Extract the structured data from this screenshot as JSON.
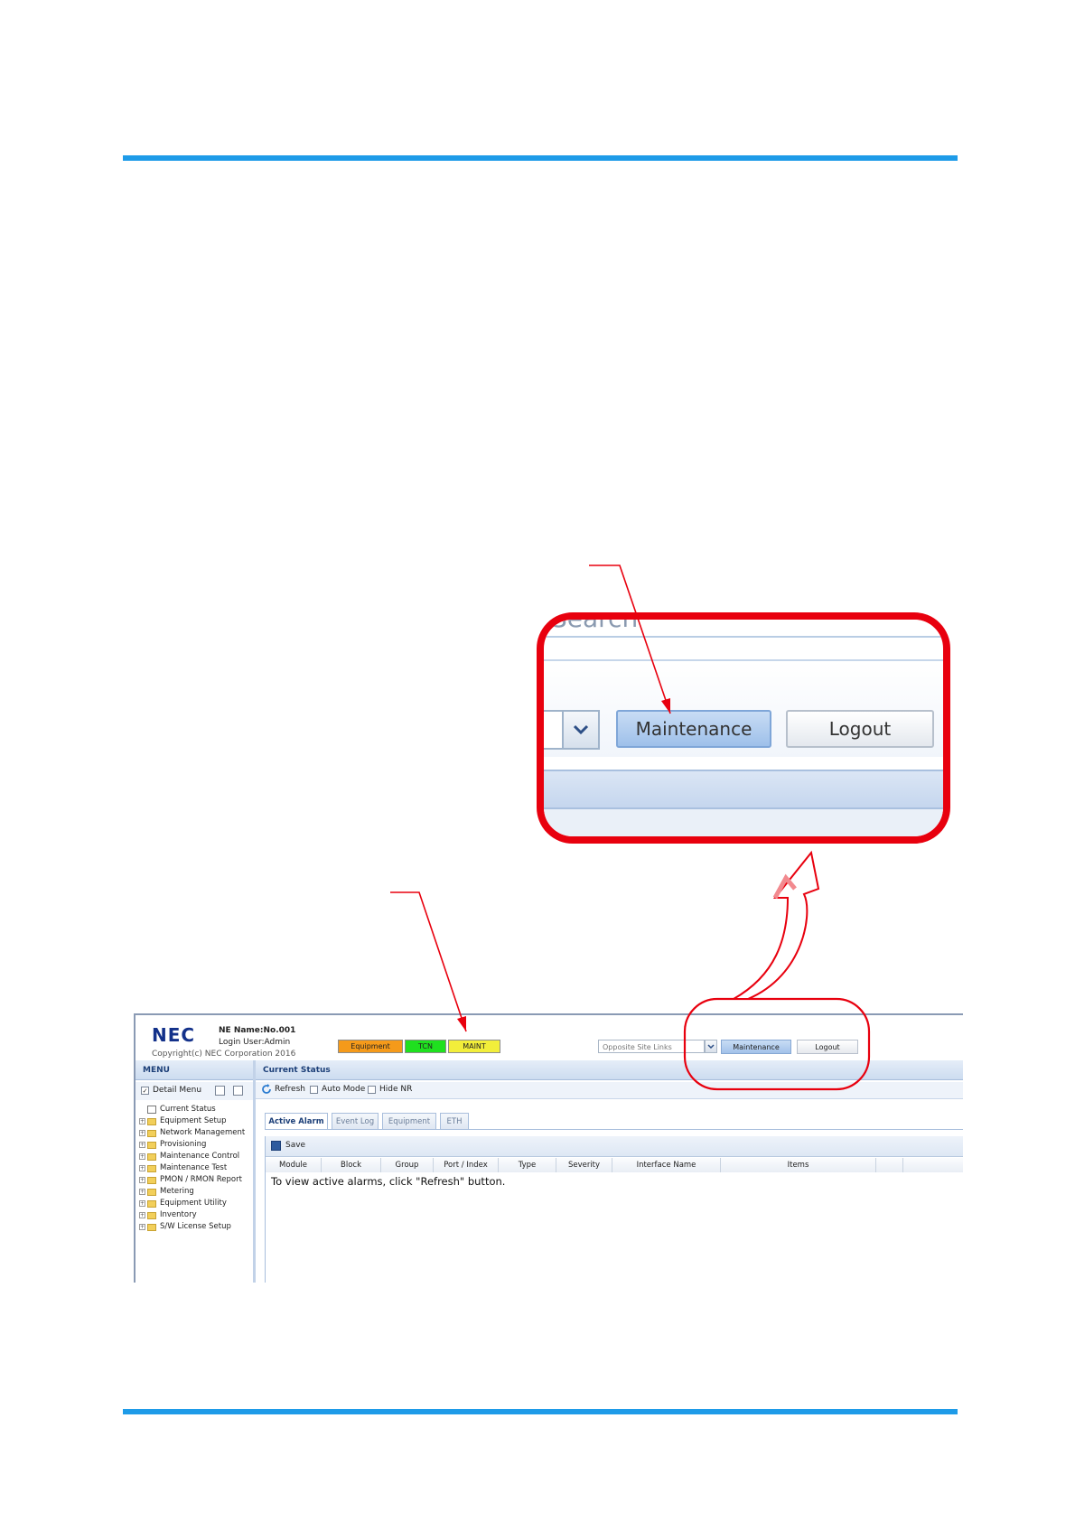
{
  "zoom": {
    "search_text": "Search",
    "maintenance_label": "Maintenance",
    "logout_label": "Logout"
  },
  "header": {
    "logo": "NEC",
    "ne_name": "NE Name:No.001",
    "login": "Login User:Admin",
    "copyright": "Copyright(c) NEC Corporation 2016",
    "badges": [
      {
        "label": "Equipment",
        "color": "#f59a1a"
      },
      {
        "label": "TCN",
        "color": "#1fe01f"
      },
      {
        "label": "MAINT",
        "color": "#f2ee3a"
      }
    ],
    "opposite_site_placeholder": "Opposite Site Links",
    "maintenance_label": "Maintenance",
    "logout_label": "Logout"
  },
  "menu": {
    "title": "MENU",
    "detail_menu_label": "Detail Menu",
    "items": [
      "Current Status",
      "Equipment Setup",
      "Network Management",
      "Provisioning",
      "Maintenance Control",
      "Maintenance Test",
      "PMON / RMON Report",
      "Metering",
      "Equipment Utility",
      "Inventory",
      "S/W License Setup"
    ]
  },
  "main": {
    "title": "Current Status",
    "refresh_label": "Refresh",
    "auto_mode_label": "Auto Mode",
    "hide_nr_label": "Hide NR",
    "tabs": [
      "Active Alarm",
      "Event Log",
      "Equipment",
      "ETH"
    ],
    "save_label": "Save",
    "columns": [
      "Module",
      "Block",
      "Group",
      "Port / Index",
      "Type",
      "Severity",
      "Interface Name",
      "Items"
    ],
    "empty_message": "To view active alarms, click \"Refresh\" button."
  },
  "colors": {
    "rule": "#1e9be8",
    "callout": "#e8000e",
    "arrow": "#e8000e"
  }
}
